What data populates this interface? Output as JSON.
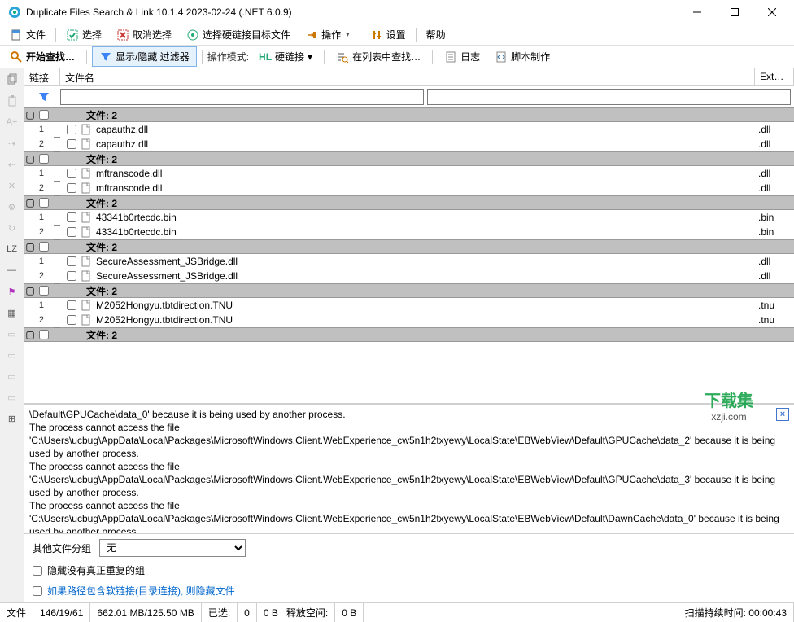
{
  "window": {
    "title": "Duplicate Files Search & Link 10.1.4 2023-02-24 (.NET 6.0.9)"
  },
  "menubar": {
    "file": "文件",
    "select": "选择",
    "deselect": "取消选择",
    "select_hardlink_target": "选择硬链接目标文件",
    "operate": "操作",
    "settings": "设置",
    "help": "帮助"
  },
  "toolbar": {
    "start_search": "开始查找…",
    "filter_toggle": "显示/隐藏 过滤器",
    "op_mode_label": "操作模式:",
    "hardlink": "硬链接",
    "search_in_list": "在列表中查找…",
    "log": "日志",
    "script": "脚本制作"
  },
  "table": {
    "col_link": "链接",
    "col_filename": "文件名",
    "col_ext": "Ext…"
  },
  "groups": [
    {
      "label": "文件: 2",
      "files": [
        {
          "name": "capauthz.dll",
          "ext": ".dll"
        },
        {
          "name": "capauthz.dll",
          "ext": ".dll"
        }
      ]
    },
    {
      "label": "文件: 2",
      "files": [
        {
          "name": "mftranscode.dll",
          "ext": ".dll"
        },
        {
          "name": "mftranscode.dll",
          "ext": ".dll"
        }
      ]
    },
    {
      "label": "文件: 2",
      "files": [
        {
          "name": "43341b0rtecdc.bin",
          "ext": ".bin"
        },
        {
          "name": "43341b0rtecdc.bin",
          "ext": ".bin"
        }
      ]
    },
    {
      "label": "文件: 2",
      "files": [
        {
          "name": "SecureAssessment_JSBridge.dll",
          "ext": ".dll"
        },
        {
          "name": "SecureAssessment_JSBridge.dll",
          "ext": ".dll"
        }
      ]
    },
    {
      "label": "文件: 2",
      "files": [
        {
          "name": "M2052Hongyu.tbtdirection.TNU",
          "ext": ".tnu"
        },
        {
          "name": "M2052Hongyu.tbtdirection.TNU",
          "ext": ".tnu"
        }
      ]
    },
    {
      "label": "文件: 2",
      "files": []
    }
  ],
  "log": {
    "lines": [
      "\\Default\\GPUCache\\data_0' because it is being used by another process.",
      "The process cannot access the file 'C:\\Users\\ucbug\\AppData\\Local\\Packages\\MicrosoftWindows.Client.WebExperience_cw5n1h2txyewy\\LocalState\\EBWebView\\Default\\GPUCache\\data_2' because it is being used by another process.",
      "The process cannot access the file 'C:\\Users\\ucbug\\AppData\\Local\\Packages\\MicrosoftWindows.Client.WebExperience_cw5n1h2txyewy\\LocalState\\EBWebView\\Default\\GPUCache\\data_3' because it is being used by another process.",
      "The process cannot access the file 'C:\\Users\\ucbug\\AppData\\Local\\Packages\\MicrosoftWindows.Client.WebExperience_cw5n1h2txyewy\\LocalState\\EBWebView\\Default\\DawnCache\\data_0' because it is being used by another process."
    ]
  },
  "bottom": {
    "other_group_label": "其他文件分组",
    "other_group_value": "无",
    "hide_no_dup": "隐藏没有真正重复的组",
    "hide_softlink": "如果路径包含软链接(目录连接), 则隐藏文件"
  },
  "status": {
    "file_label": "文件",
    "counts": "146/19/61",
    "size": "662.01 MB/125.50 MB",
    "selected_label": "已选:",
    "selected_count": "0",
    "selected_size": "0 B",
    "free_label": "释放空间:",
    "free_size": "0 B",
    "scan_time_label": "扫描持续时间:",
    "scan_time": "00:00:43"
  },
  "watermark": {
    "text": "下载集",
    "url": "xzji.com"
  }
}
